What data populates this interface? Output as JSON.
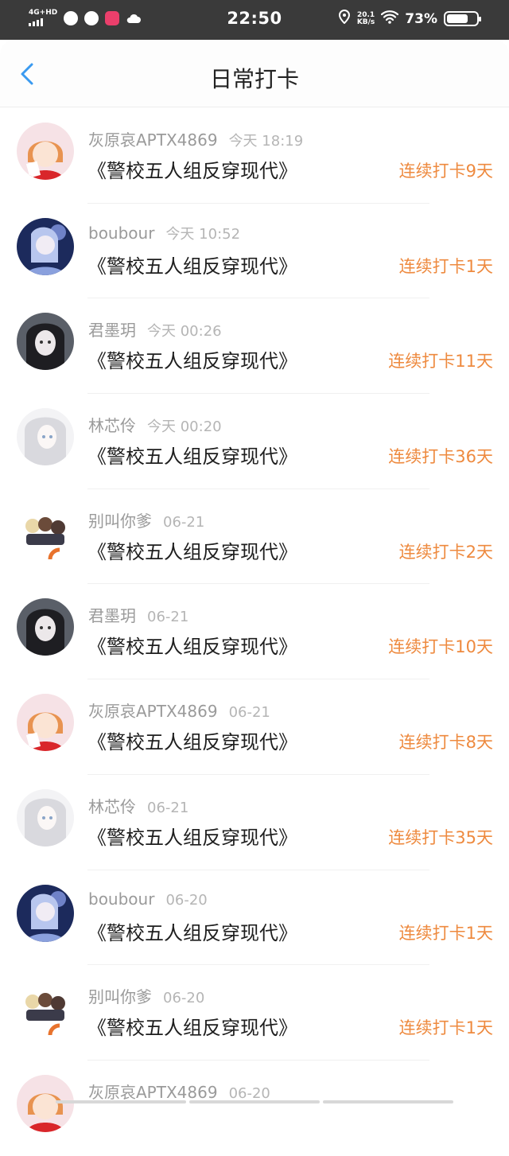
{
  "status_bar": {
    "network": "4G+HD",
    "time": "22:50",
    "speed_value": "20.1",
    "speed_unit": "KB/s",
    "battery": "73%"
  },
  "nav": {
    "title": "日常打卡",
    "back_icon": "chevron-left-icon",
    "accent": "#3a9af0"
  },
  "colors": {
    "streak": "#ee8a3f",
    "status_bar_bg": "#3a3a3a"
  },
  "entries": [
    {
      "user": "灰原哀APTX4869",
      "time": "今天 18:19",
      "book": "《警校五人组反穿现代》",
      "streak": "连续打卡9天",
      "avatar": "orange-hair-girl-avatar"
    },
    {
      "user": "boubour",
      "time": "今天 10:52",
      "book": "《警校五人组反穿现代》",
      "streak": "连续打卡1天",
      "avatar": "blue-anime-girl-avatar"
    },
    {
      "user": "君墨玥",
      "time": "今天 00:26",
      "book": "《警校五人组反穿现代》",
      "streak": "连续打卡11天",
      "avatar": "dark-hair-girl-avatar"
    },
    {
      "user": "林芯伶",
      "time": "今天 00:20",
      "book": "《警校五人组反穿现代》",
      "streak": "连续打卡36天",
      "avatar": "white-hair-girl-avatar"
    },
    {
      "user": "别叫你爹",
      "time": "06-21",
      "book": "《警校五人组反穿现代》",
      "streak": "连续打卡2天",
      "avatar": "chibi-group-avatar"
    },
    {
      "user": "君墨玥",
      "time": "06-21",
      "book": "《警校五人组反穿现代》",
      "streak": "连续打卡10天",
      "avatar": "dark-hair-girl-avatar"
    },
    {
      "user": "灰原哀APTX4869",
      "time": "06-21",
      "book": "《警校五人组反穿现代》",
      "streak": "连续打卡8天",
      "avatar": "orange-hair-girl-avatar"
    },
    {
      "user": "林芯伶",
      "time": "06-21",
      "book": "《警校五人组反穿现代》",
      "streak": "连续打卡35天",
      "avatar": "white-hair-girl-avatar"
    },
    {
      "user": "boubour",
      "time": "06-20",
      "book": "《警校五人组反穿现代》",
      "streak": "连续打卡1天",
      "avatar": "blue-anime-girl-avatar"
    },
    {
      "user": "别叫你爹",
      "time": "06-20",
      "book": "《警校五人组反穿现代》",
      "streak": "连续打卡1天",
      "avatar": "chibi-group-avatar"
    },
    {
      "user": "灰原哀APTX4869",
      "time": "06-20",
      "book": "",
      "streak": "",
      "avatar": "orange-hair-girl-avatar"
    }
  ]
}
